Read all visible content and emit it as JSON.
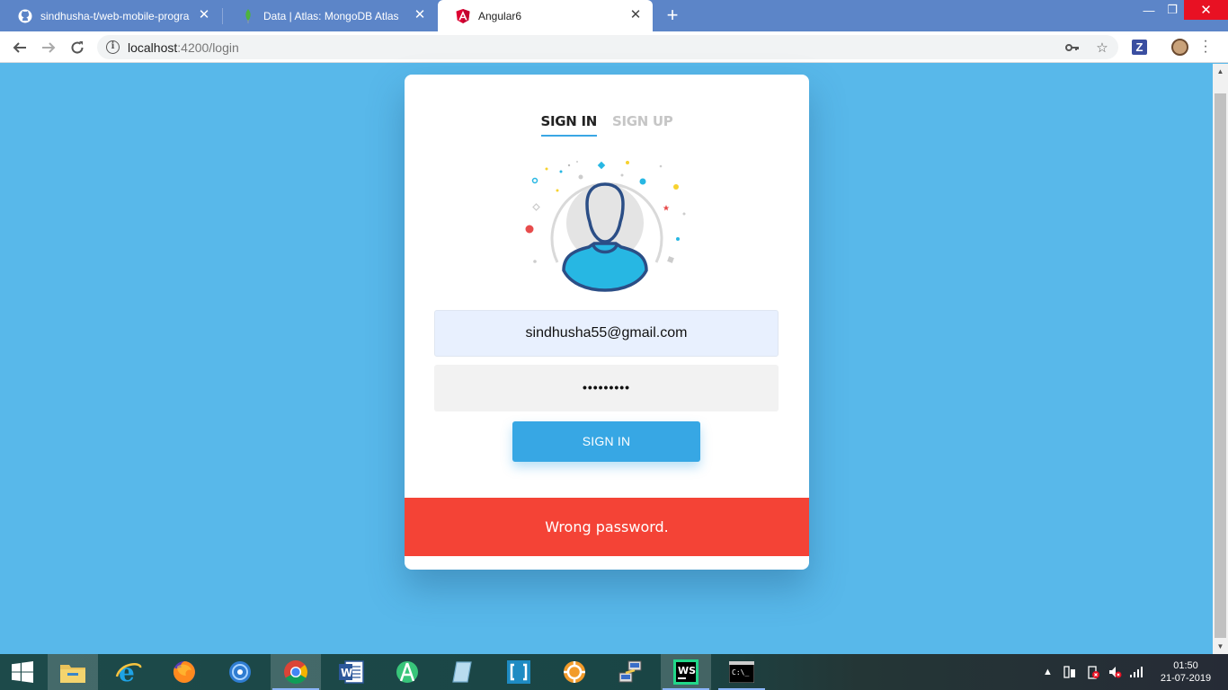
{
  "browser": {
    "tabs": [
      {
        "title": "sindhusha-t/web-mobile-progra",
        "icon": "github-icon",
        "active": false
      },
      {
        "title": "Data | Atlas: MongoDB Atlas",
        "icon": "mongodb-leaf-icon",
        "active": false
      },
      {
        "title": "Angular6",
        "icon": "angular-icon",
        "active": true
      }
    ],
    "url_host": "localhost",
    "url_path": ":4200/login",
    "win_min": "—",
    "win_max": "❐",
    "win_close": "✕",
    "new_tab": "+"
  },
  "login": {
    "tab_signin": "SIGN IN",
    "tab_signup": "SIGN UP",
    "email_value": "sindhusha55@gmail.com",
    "password_value": "•••••••••",
    "signin_button": "SIGN IN",
    "error_message": "Wrong password."
  },
  "taskbar": {
    "apps": [
      "file-explorer-icon",
      "internet-explorer-icon",
      "firefox-icon",
      "app-icon",
      "chrome-icon",
      "word-icon",
      "android-studio-icon",
      "notepad-icon",
      "bracket-app-icon",
      "settings-app-icon",
      "network-app-icon",
      "webstorm-icon",
      "cmd-icon"
    ],
    "time": "01:50",
    "date": "21-07-2019"
  },
  "colors": {
    "page_bg": "#58b8ea",
    "accent": "#37a7e4",
    "error": "#f44336",
    "tabstrip": "#5c85c8"
  }
}
